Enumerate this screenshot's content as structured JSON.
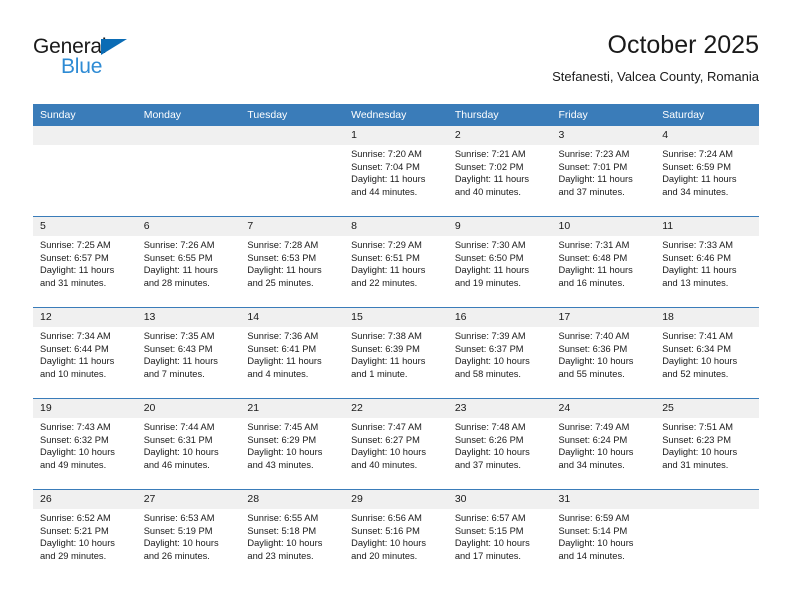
{
  "brand": {
    "name_top": "General",
    "name_bottom": "Blue",
    "flag_icon": "triangle-flag-icon",
    "color_dark": "#1a1a1a",
    "color_blue": "#2e8bd4",
    "flag_color": "#0b6cb5"
  },
  "header": {
    "title": "October 2025",
    "subtitle": "Stefanesti, Valcea County, Romania"
  },
  "theme": {
    "header_band": "#3a7cb9",
    "daynum_band": "#f0f0f0",
    "text": "#1a1a1a"
  },
  "weekday_headers": [
    "Sunday",
    "Monday",
    "Tuesday",
    "Wednesday",
    "Thursday",
    "Friday",
    "Saturday"
  ],
  "weeks": [
    [
      {
        "day": "",
        "sunrise": "",
        "sunset": "",
        "daylight_l1": "",
        "daylight_l2": ""
      },
      {
        "day": "",
        "sunrise": "",
        "sunset": "",
        "daylight_l1": "",
        "daylight_l2": ""
      },
      {
        "day": "",
        "sunrise": "",
        "sunset": "",
        "daylight_l1": "",
        "daylight_l2": ""
      },
      {
        "day": "1",
        "sunrise": "Sunrise: 7:20 AM",
        "sunset": "Sunset: 7:04 PM",
        "daylight_l1": "Daylight: 11 hours",
        "daylight_l2": "and 44 minutes."
      },
      {
        "day": "2",
        "sunrise": "Sunrise: 7:21 AM",
        "sunset": "Sunset: 7:02 PM",
        "daylight_l1": "Daylight: 11 hours",
        "daylight_l2": "and 40 minutes."
      },
      {
        "day": "3",
        "sunrise": "Sunrise: 7:23 AM",
        "sunset": "Sunset: 7:01 PM",
        "daylight_l1": "Daylight: 11 hours",
        "daylight_l2": "and 37 minutes."
      },
      {
        "day": "4",
        "sunrise": "Sunrise: 7:24 AM",
        "sunset": "Sunset: 6:59 PM",
        "daylight_l1": "Daylight: 11 hours",
        "daylight_l2": "and 34 minutes."
      }
    ],
    [
      {
        "day": "5",
        "sunrise": "Sunrise: 7:25 AM",
        "sunset": "Sunset: 6:57 PM",
        "daylight_l1": "Daylight: 11 hours",
        "daylight_l2": "and 31 minutes."
      },
      {
        "day": "6",
        "sunrise": "Sunrise: 7:26 AM",
        "sunset": "Sunset: 6:55 PM",
        "daylight_l1": "Daylight: 11 hours",
        "daylight_l2": "and 28 minutes."
      },
      {
        "day": "7",
        "sunrise": "Sunrise: 7:28 AM",
        "sunset": "Sunset: 6:53 PM",
        "daylight_l1": "Daylight: 11 hours",
        "daylight_l2": "and 25 minutes."
      },
      {
        "day": "8",
        "sunrise": "Sunrise: 7:29 AM",
        "sunset": "Sunset: 6:51 PM",
        "daylight_l1": "Daylight: 11 hours",
        "daylight_l2": "and 22 minutes."
      },
      {
        "day": "9",
        "sunrise": "Sunrise: 7:30 AM",
        "sunset": "Sunset: 6:50 PM",
        "daylight_l1": "Daylight: 11 hours",
        "daylight_l2": "and 19 minutes."
      },
      {
        "day": "10",
        "sunrise": "Sunrise: 7:31 AM",
        "sunset": "Sunset: 6:48 PM",
        "daylight_l1": "Daylight: 11 hours",
        "daylight_l2": "and 16 minutes."
      },
      {
        "day": "11",
        "sunrise": "Sunrise: 7:33 AM",
        "sunset": "Sunset: 6:46 PM",
        "daylight_l1": "Daylight: 11 hours",
        "daylight_l2": "and 13 minutes."
      }
    ],
    [
      {
        "day": "12",
        "sunrise": "Sunrise: 7:34 AM",
        "sunset": "Sunset: 6:44 PM",
        "daylight_l1": "Daylight: 11 hours",
        "daylight_l2": "and 10 minutes."
      },
      {
        "day": "13",
        "sunrise": "Sunrise: 7:35 AM",
        "sunset": "Sunset: 6:43 PM",
        "daylight_l1": "Daylight: 11 hours",
        "daylight_l2": "and 7 minutes."
      },
      {
        "day": "14",
        "sunrise": "Sunrise: 7:36 AM",
        "sunset": "Sunset: 6:41 PM",
        "daylight_l1": "Daylight: 11 hours",
        "daylight_l2": "and 4 minutes."
      },
      {
        "day": "15",
        "sunrise": "Sunrise: 7:38 AM",
        "sunset": "Sunset: 6:39 PM",
        "daylight_l1": "Daylight: 11 hours",
        "daylight_l2": "and 1 minute."
      },
      {
        "day": "16",
        "sunrise": "Sunrise: 7:39 AM",
        "sunset": "Sunset: 6:37 PM",
        "daylight_l1": "Daylight: 10 hours",
        "daylight_l2": "and 58 minutes."
      },
      {
        "day": "17",
        "sunrise": "Sunrise: 7:40 AM",
        "sunset": "Sunset: 6:36 PM",
        "daylight_l1": "Daylight: 10 hours",
        "daylight_l2": "and 55 minutes."
      },
      {
        "day": "18",
        "sunrise": "Sunrise: 7:41 AM",
        "sunset": "Sunset: 6:34 PM",
        "daylight_l1": "Daylight: 10 hours",
        "daylight_l2": "and 52 minutes."
      }
    ],
    [
      {
        "day": "19",
        "sunrise": "Sunrise: 7:43 AM",
        "sunset": "Sunset: 6:32 PM",
        "daylight_l1": "Daylight: 10 hours",
        "daylight_l2": "and 49 minutes."
      },
      {
        "day": "20",
        "sunrise": "Sunrise: 7:44 AM",
        "sunset": "Sunset: 6:31 PM",
        "daylight_l1": "Daylight: 10 hours",
        "daylight_l2": "and 46 minutes."
      },
      {
        "day": "21",
        "sunrise": "Sunrise: 7:45 AM",
        "sunset": "Sunset: 6:29 PM",
        "daylight_l1": "Daylight: 10 hours",
        "daylight_l2": "and 43 minutes."
      },
      {
        "day": "22",
        "sunrise": "Sunrise: 7:47 AM",
        "sunset": "Sunset: 6:27 PM",
        "daylight_l1": "Daylight: 10 hours",
        "daylight_l2": "and 40 minutes."
      },
      {
        "day": "23",
        "sunrise": "Sunrise: 7:48 AM",
        "sunset": "Sunset: 6:26 PM",
        "daylight_l1": "Daylight: 10 hours",
        "daylight_l2": "and 37 minutes."
      },
      {
        "day": "24",
        "sunrise": "Sunrise: 7:49 AM",
        "sunset": "Sunset: 6:24 PM",
        "daylight_l1": "Daylight: 10 hours",
        "daylight_l2": "and 34 minutes."
      },
      {
        "day": "25",
        "sunrise": "Sunrise: 7:51 AM",
        "sunset": "Sunset: 6:23 PM",
        "daylight_l1": "Daylight: 10 hours",
        "daylight_l2": "and 31 minutes."
      }
    ],
    [
      {
        "day": "26",
        "sunrise": "Sunrise: 6:52 AM",
        "sunset": "Sunset: 5:21 PM",
        "daylight_l1": "Daylight: 10 hours",
        "daylight_l2": "and 29 minutes."
      },
      {
        "day": "27",
        "sunrise": "Sunrise: 6:53 AM",
        "sunset": "Sunset: 5:19 PM",
        "daylight_l1": "Daylight: 10 hours",
        "daylight_l2": "and 26 minutes."
      },
      {
        "day": "28",
        "sunrise": "Sunrise: 6:55 AM",
        "sunset": "Sunset: 5:18 PM",
        "daylight_l1": "Daylight: 10 hours",
        "daylight_l2": "and 23 minutes."
      },
      {
        "day": "29",
        "sunrise": "Sunrise: 6:56 AM",
        "sunset": "Sunset: 5:16 PM",
        "daylight_l1": "Daylight: 10 hours",
        "daylight_l2": "and 20 minutes."
      },
      {
        "day": "30",
        "sunrise": "Sunrise: 6:57 AM",
        "sunset": "Sunset: 5:15 PM",
        "daylight_l1": "Daylight: 10 hours",
        "daylight_l2": "and 17 minutes."
      },
      {
        "day": "31",
        "sunrise": "Sunrise: 6:59 AM",
        "sunset": "Sunset: 5:14 PM",
        "daylight_l1": "Daylight: 10 hours",
        "daylight_l2": "and 14 minutes."
      },
      {
        "day": "",
        "sunrise": "",
        "sunset": "",
        "daylight_l1": "",
        "daylight_l2": ""
      }
    ]
  ]
}
